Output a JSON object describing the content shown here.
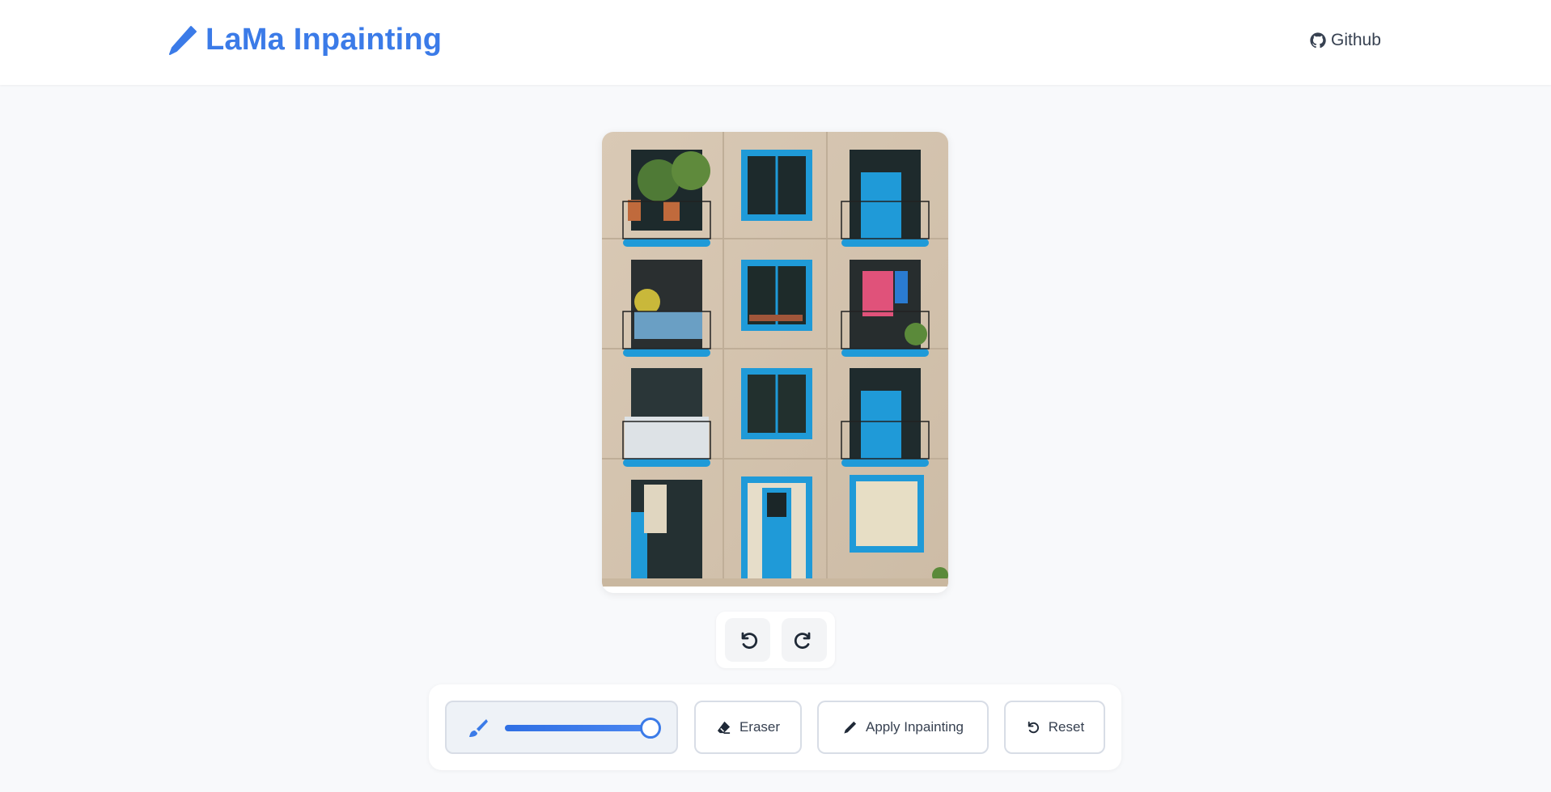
{
  "header": {
    "title": "LaMa Inpainting",
    "brand_icon": "pencil-icon",
    "github_label": "Github",
    "github_icon": "github-icon"
  },
  "canvas": {
    "image_description_icon": "building-facade-image",
    "accent_color": "#3b7be8"
  },
  "history": {
    "undo_icon": "undo-icon",
    "redo_icon": "redo-icon"
  },
  "toolbar": {
    "brush_icon": "brush-icon",
    "brush_size_fraction": 1.0,
    "eraser_label": "Eraser",
    "eraser_icon": "eraser-icon",
    "apply_label": "Apply Inpainting",
    "apply_icon": "pencil-icon",
    "reset_label": "Reset",
    "reset_icon": "reset-icon"
  },
  "colors": {
    "brand": "#3b7be8",
    "background": "#f8f9fb",
    "window_blue": "#1f9ad8",
    "facade": "#d8c8b4"
  }
}
